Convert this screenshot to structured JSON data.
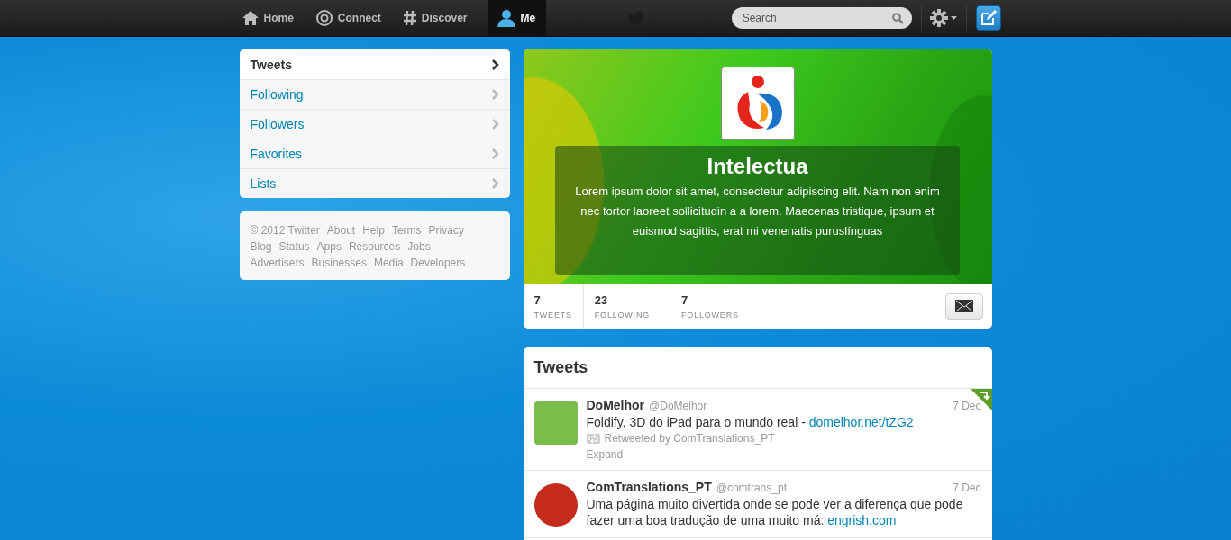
{
  "topbar": {
    "nav": [
      {
        "label": "Home",
        "kind": "home",
        "selected": false
      },
      {
        "label": "Connect",
        "kind": "at",
        "selected": false
      },
      {
        "label": "Discover",
        "kind": "hash",
        "selected": false
      },
      {
        "label": "Me",
        "kind": "person",
        "selected": true
      }
    ],
    "search": {
      "placeholder": "Search"
    }
  },
  "sidebar": {
    "items": [
      {
        "label": "Tweets",
        "selected": true
      },
      {
        "label": "Following",
        "selected": false
      },
      {
        "label": "Followers",
        "selected": false
      },
      {
        "label": "Favorites",
        "selected": false
      },
      {
        "label": "Lists",
        "selected": false
      }
    ]
  },
  "footer": {
    "copyright": "© 2012 Twitter",
    "rows": [
      [
        "About",
        "Help",
        "Terms",
        "Privacy"
      ],
      [
        "Blog",
        "Status",
        "Apps",
        "Resources",
        "Jobs"
      ],
      [
        "Advertisers",
        "Businesses",
        "Media",
        "Developers"
      ]
    ]
  },
  "profile": {
    "name": "Intelectua",
    "bio": "Lorem ipsum dolor sit amet, consectetur adipiscing elit. Nam non enim nec tortor laoreet sollicitudin a a lorem. Maecenas tristique, ipsum et euismod sagittis, erat mi venenatis puruslínguas",
    "stats": [
      {
        "value": "7",
        "label": "TWEETS"
      },
      {
        "value": "23",
        "label": "FOLLOWING"
      },
      {
        "value": "7",
        "label": "FOLLOWERS"
      }
    ]
  },
  "tweets": {
    "title": "Tweets",
    "items": [
      {
        "name": "DoMelhor",
        "handle": "@DoMelhor",
        "date": "7 Dec",
        "text": "Foldify, 3D do iPad para o mundo real - ",
        "link": "domelhor.net/tZG2",
        "retweeted_by": "Retweeted by ComTranslations_PT",
        "expand": "Expand",
        "retweeted": true
      },
      {
        "name": "ComTranslations_PT",
        "handle": "@comtrans_pt",
        "date": "7 Dec",
        "text": "Uma página muito divertida onde se pode ver a diferença que pode fazer uma boa tradução de uma muito má: ",
        "link": "engrish.com",
        "retweeted": false
      }
    ]
  }
}
